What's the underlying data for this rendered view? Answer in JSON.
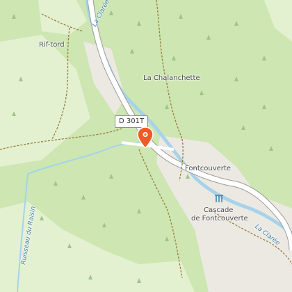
{
  "map": {
    "road_label": "D 301T",
    "places": {
      "rif_tord": "Rif-tord",
      "la_chalanchette": "La Chalanchette",
      "fontcouverte": "Fontcouverte",
      "cascade_line1": "Cascade",
      "cascade_line2": "de Fontcouverte"
    },
    "water": {
      "la_claree_north": "La Clarée",
      "la_claree_south": "La Clarée",
      "ruisseau": "Ruisseau du Raisin"
    },
    "colors": {
      "forest": "#cde6b2",
      "meadow": "#e3f1d0",
      "settlement": "#ece9e3",
      "road": "#ffffff",
      "road_casing": "#9b9b9b",
      "river": "#a7d3ea",
      "path": "#9a7a3d",
      "marker": "#f05a28"
    },
    "icons": [
      "map-pin-icon",
      "waterfall-icon",
      "tree-icon"
    ]
  }
}
